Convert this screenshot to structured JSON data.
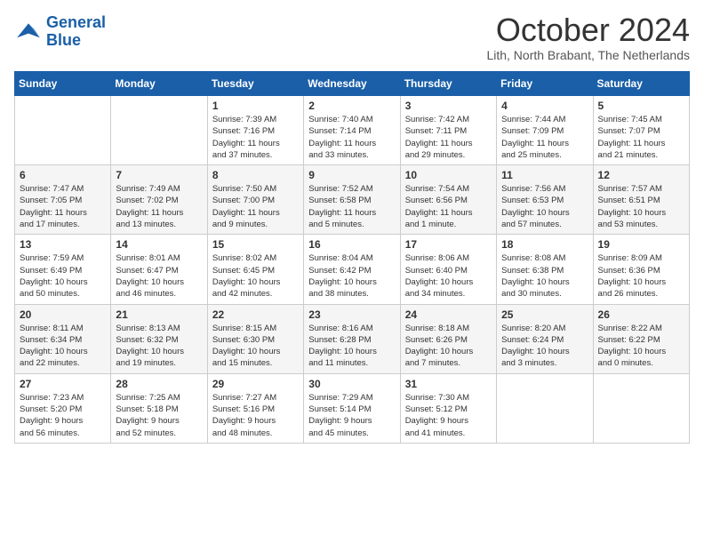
{
  "header": {
    "logo_line1": "General",
    "logo_line2": "Blue",
    "month_title": "October 2024",
    "location": "Lith, North Brabant, The Netherlands"
  },
  "days_of_week": [
    "Sunday",
    "Monday",
    "Tuesday",
    "Wednesday",
    "Thursday",
    "Friday",
    "Saturday"
  ],
  "weeks": [
    [
      {
        "day": "",
        "info": ""
      },
      {
        "day": "",
        "info": ""
      },
      {
        "day": "1",
        "info": "Sunrise: 7:39 AM\nSunset: 7:16 PM\nDaylight: 11 hours\nand 37 minutes."
      },
      {
        "day": "2",
        "info": "Sunrise: 7:40 AM\nSunset: 7:14 PM\nDaylight: 11 hours\nand 33 minutes."
      },
      {
        "day": "3",
        "info": "Sunrise: 7:42 AM\nSunset: 7:11 PM\nDaylight: 11 hours\nand 29 minutes."
      },
      {
        "day": "4",
        "info": "Sunrise: 7:44 AM\nSunset: 7:09 PM\nDaylight: 11 hours\nand 25 minutes."
      },
      {
        "day": "5",
        "info": "Sunrise: 7:45 AM\nSunset: 7:07 PM\nDaylight: 11 hours\nand 21 minutes."
      }
    ],
    [
      {
        "day": "6",
        "info": "Sunrise: 7:47 AM\nSunset: 7:05 PM\nDaylight: 11 hours\nand 17 minutes."
      },
      {
        "day": "7",
        "info": "Sunrise: 7:49 AM\nSunset: 7:02 PM\nDaylight: 11 hours\nand 13 minutes."
      },
      {
        "day": "8",
        "info": "Sunrise: 7:50 AM\nSunset: 7:00 PM\nDaylight: 11 hours\nand 9 minutes."
      },
      {
        "day": "9",
        "info": "Sunrise: 7:52 AM\nSunset: 6:58 PM\nDaylight: 11 hours\nand 5 minutes."
      },
      {
        "day": "10",
        "info": "Sunrise: 7:54 AM\nSunset: 6:56 PM\nDaylight: 11 hours\nand 1 minute."
      },
      {
        "day": "11",
        "info": "Sunrise: 7:56 AM\nSunset: 6:53 PM\nDaylight: 10 hours\nand 57 minutes."
      },
      {
        "day": "12",
        "info": "Sunrise: 7:57 AM\nSunset: 6:51 PM\nDaylight: 10 hours\nand 53 minutes."
      }
    ],
    [
      {
        "day": "13",
        "info": "Sunrise: 7:59 AM\nSunset: 6:49 PM\nDaylight: 10 hours\nand 50 minutes."
      },
      {
        "day": "14",
        "info": "Sunrise: 8:01 AM\nSunset: 6:47 PM\nDaylight: 10 hours\nand 46 minutes."
      },
      {
        "day": "15",
        "info": "Sunrise: 8:02 AM\nSunset: 6:45 PM\nDaylight: 10 hours\nand 42 minutes."
      },
      {
        "day": "16",
        "info": "Sunrise: 8:04 AM\nSunset: 6:42 PM\nDaylight: 10 hours\nand 38 minutes."
      },
      {
        "day": "17",
        "info": "Sunrise: 8:06 AM\nSunset: 6:40 PM\nDaylight: 10 hours\nand 34 minutes."
      },
      {
        "day": "18",
        "info": "Sunrise: 8:08 AM\nSunset: 6:38 PM\nDaylight: 10 hours\nand 30 minutes."
      },
      {
        "day": "19",
        "info": "Sunrise: 8:09 AM\nSunset: 6:36 PM\nDaylight: 10 hours\nand 26 minutes."
      }
    ],
    [
      {
        "day": "20",
        "info": "Sunrise: 8:11 AM\nSunset: 6:34 PM\nDaylight: 10 hours\nand 22 minutes."
      },
      {
        "day": "21",
        "info": "Sunrise: 8:13 AM\nSunset: 6:32 PM\nDaylight: 10 hours\nand 19 minutes."
      },
      {
        "day": "22",
        "info": "Sunrise: 8:15 AM\nSunset: 6:30 PM\nDaylight: 10 hours\nand 15 minutes."
      },
      {
        "day": "23",
        "info": "Sunrise: 8:16 AM\nSunset: 6:28 PM\nDaylight: 10 hours\nand 11 minutes."
      },
      {
        "day": "24",
        "info": "Sunrise: 8:18 AM\nSunset: 6:26 PM\nDaylight: 10 hours\nand 7 minutes."
      },
      {
        "day": "25",
        "info": "Sunrise: 8:20 AM\nSunset: 6:24 PM\nDaylight: 10 hours\nand 3 minutes."
      },
      {
        "day": "26",
        "info": "Sunrise: 8:22 AM\nSunset: 6:22 PM\nDaylight: 10 hours\nand 0 minutes."
      }
    ],
    [
      {
        "day": "27",
        "info": "Sunrise: 7:23 AM\nSunset: 5:20 PM\nDaylight: 9 hours\nand 56 minutes."
      },
      {
        "day": "28",
        "info": "Sunrise: 7:25 AM\nSunset: 5:18 PM\nDaylight: 9 hours\nand 52 minutes."
      },
      {
        "day": "29",
        "info": "Sunrise: 7:27 AM\nSunset: 5:16 PM\nDaylight: 9 hours\nand 48 minutes."
      },
      {
        "day": "30",
        "info": "Sunrise: 7:29 AM\nSunset: 5:14 PM\nDaylight: 9 hours\nand 45 minutes."
      },
      {
        "day": "31",
        "info": "Sunrise: 7:30 AM\nSunset: 5:12 PM\nDaylight: 9 hours\nand 41 minutes."
      },
      {
        "day": "",
        "info": ""
      },
      {
        "day": "",
        "info": ""
      }
    ]
  ]
}
